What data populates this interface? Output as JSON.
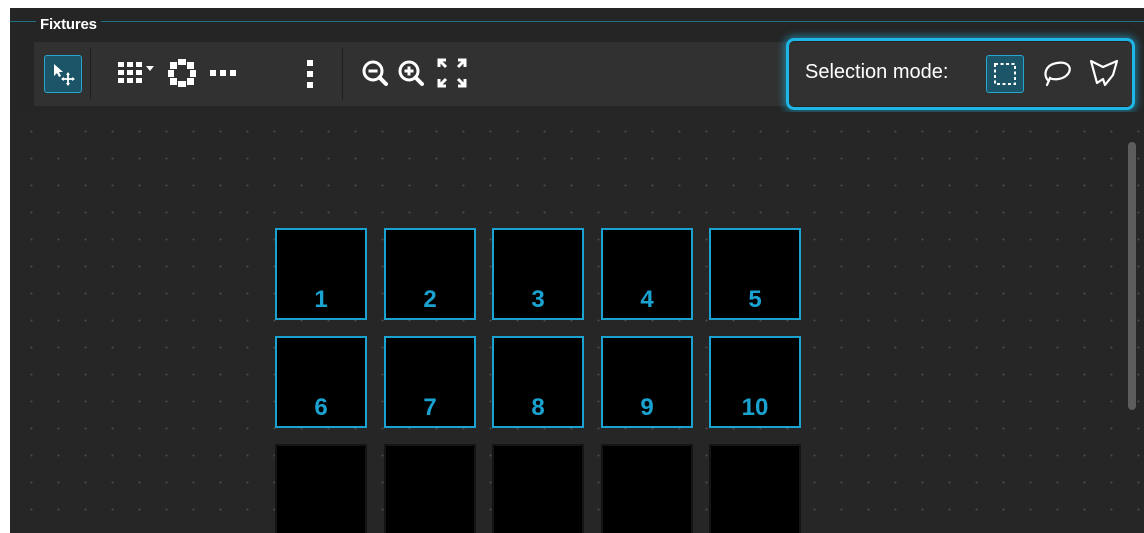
{
  "panel": {
    "title": "Fixtures"
  },
  "toolbar": {
    "tools": [
      {
        "name": "select-move-icon",
        "active": true
      },
      {
        "name": "grid-layout-dropdown-icon",
        "active": false
      },
      {
        "name": "circle-layout-icon",
        "active": false
      },
      {
        "name": "horizontal-line-layout-icon",
        "active": false
      },
      {
        "name": "vertical-line-layout-icon",
        "active": false
      },
      {
        "name": "zoom-out-icon",
        "active": false
      },
      {
        "name": "zoom-in-icon",
        "active": false
      },
      {
        "name": "zoom-fit-icon",
        "active": false
      }
    ],
    "selection_mode": {
      "label": "Selection mode:",
      "modes": [
        {
          "name": "rectangle-select-icon",
          "active": true
        },
        {
          "name": "lasso-select-icon",
          "active": false
        },
        {
          "name": "polygon-select-icon",
          "active": false
        }
      ]
    }
  },
  "colors": {
    "accent": "#1aa3d1",
    "highlight": "#1eb6e6",
    "panel_bg": "#252525",
    "fixture_bg": "#000000"
  },
  "fixtures": [
    {
      "label": "1",
      "selected": true
    },
    {
      "label": "2",
      "selected": true
    },
    {
      "label": "3",
      "selected": true
    },
    {
      "label": "4",
      "selected": true
    },
    {
      "label": "5",
      "selected": true
    },
    {
      "label": "6",
      "selected": true
    },
    {
      "label": "7",
      "selected": true
    },
    {
      "label": "8",
      "selected": true
    },
    {
      "label": "9",
      "selected": true
    },
    {
      "label": "10",
      "selected": true
    },
    {
      "label": "",
      "selected": false
    },
    {
      "label": "",
      "selected": false
    },
    {
      "label": "",
      "selected": false
    },
    {
      "label": "",
      "selected": false
    },
    {
      "label": "",
      "selected": false
    }
  ]
}
